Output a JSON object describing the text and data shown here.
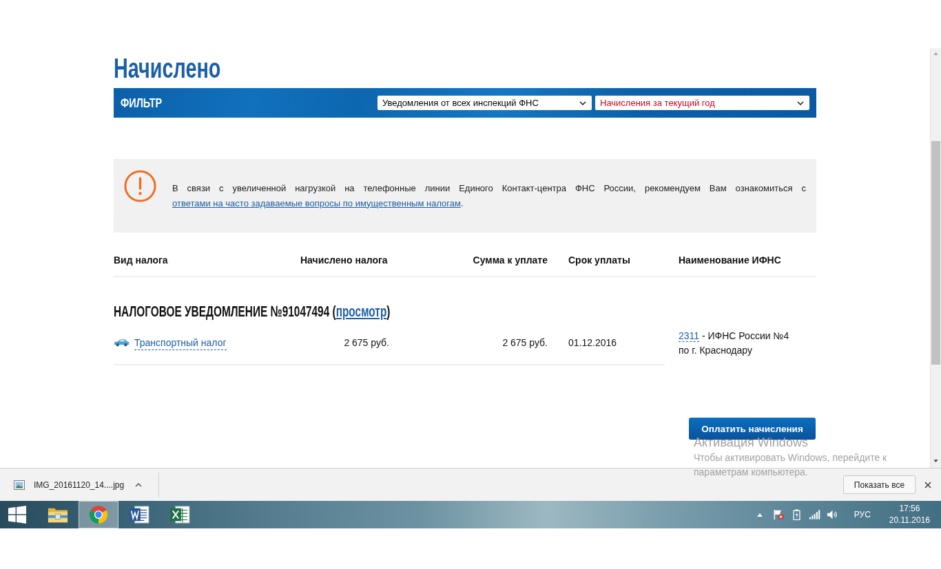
{
  "page": {
    "title": "Начислено"
  },
  "filter": {
    "label": "ФИЛЬТР",
    "selects": [
      {
        "value": "Уведомления от всех инспекций ФНС",
        "color": "#000000"
      },
      {
        "value": "Начисления за текущий год",
        "color": "#d0021b"
      }
    ]
  },
  "notice": {
    "text": "В связи с увеличенной нагрузкой на телефонные линии Единого Контакт-центра ФНС России, рекомендуем Вам ознакомиться с",
    "link": "ответами на часто задаваемые вопросы по имущественным налогам",
    "end": "."
  },
  "table": {
    "columns": [
      "Вид налога",
      "Начислено налога",
      "Сумма к уплате",
      "Срок уплаты",
      "Наименование ИФНС"
    ],
    "notices": [
      {
        "title": "НАЛОГОВОЕ УВЕДОМЛЕНИЕ №91047494 (",
        "link": "просмотр",
        "title_end": ")",
        "rows": [
          {
            "tax": "Транспортный налог",
            "accrued": "2 675 руб.",
            "payable": "2 675 руб.",
            "due_date": "01.12.2016",
            "inspection_code": "2311",
            "inspection_name": "- ИФНС России №4 по г. Краснодару"
          }
        ]
      }
    ]
  },
  "actions": {
    "pay": "Оплатить начисления"
  },
  "activation_notice": {
    "title": "Активация Windows",
    "text": "Чтобы активировать Windows, перейдите к параметрам компьютера."
  },
  "downloads": {
    "items": [
      {
        "filename": "IMG_20161120_14....jpg"
      }
    ],
    "show_all": "Показать все"
  },
  "taskbar": {
    "apps": [
      {
        "kind": "folder",
        "selected": false
      },
      {
        "kind": "browser",
        "selected": true
      },
      {
        "kind": "word",
        "selected": false
      },
      {
        "kind": "excel",
        "selected": false
      }
    ],
    "language": "РУС",
    "time": "17:56",
    "date": "20.11.2016"
  }
}
